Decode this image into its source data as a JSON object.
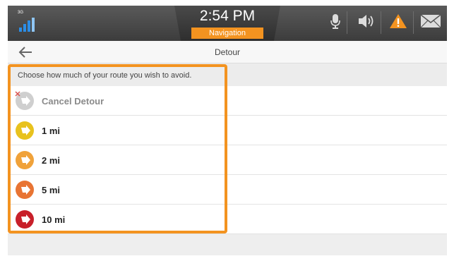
{
  "status_bar": {
    "network_label": "3G",
    "time": "2:54 PM",
    "app_label": "Navigation",
    "icons": [
      "signal-icon",
      "microphone-icon",
      "speaker-icon",
      "warning-icon",
      "mail-icon"
    ]
  },
  "title_bar": {
    "title": "Detour",
    "back_icon": "back-arrow-icon"
  },
  "instruction": "Choose how much of your route you wish to avoid.",
  "options": [
    {
      "label": "Cancel Detour",
      "color": "#cfcfcf"
    },
    {
      "label": "1 mi",
      "color": "#e8c21e"
    },
    {
      "label": "2 mi",
      "color": "#f0a23a"
    },
    {
      "label": "5 mi",
      "color": "#e87433"
    },
    {
      "label": "10 mi",
      "color": "#c8202a"
    }
  ],
  "colors": {
    "accent": "#f39320",
    "signal": "#2b8de6",
    "cancel_mark": "#d9534f"
  }
}
